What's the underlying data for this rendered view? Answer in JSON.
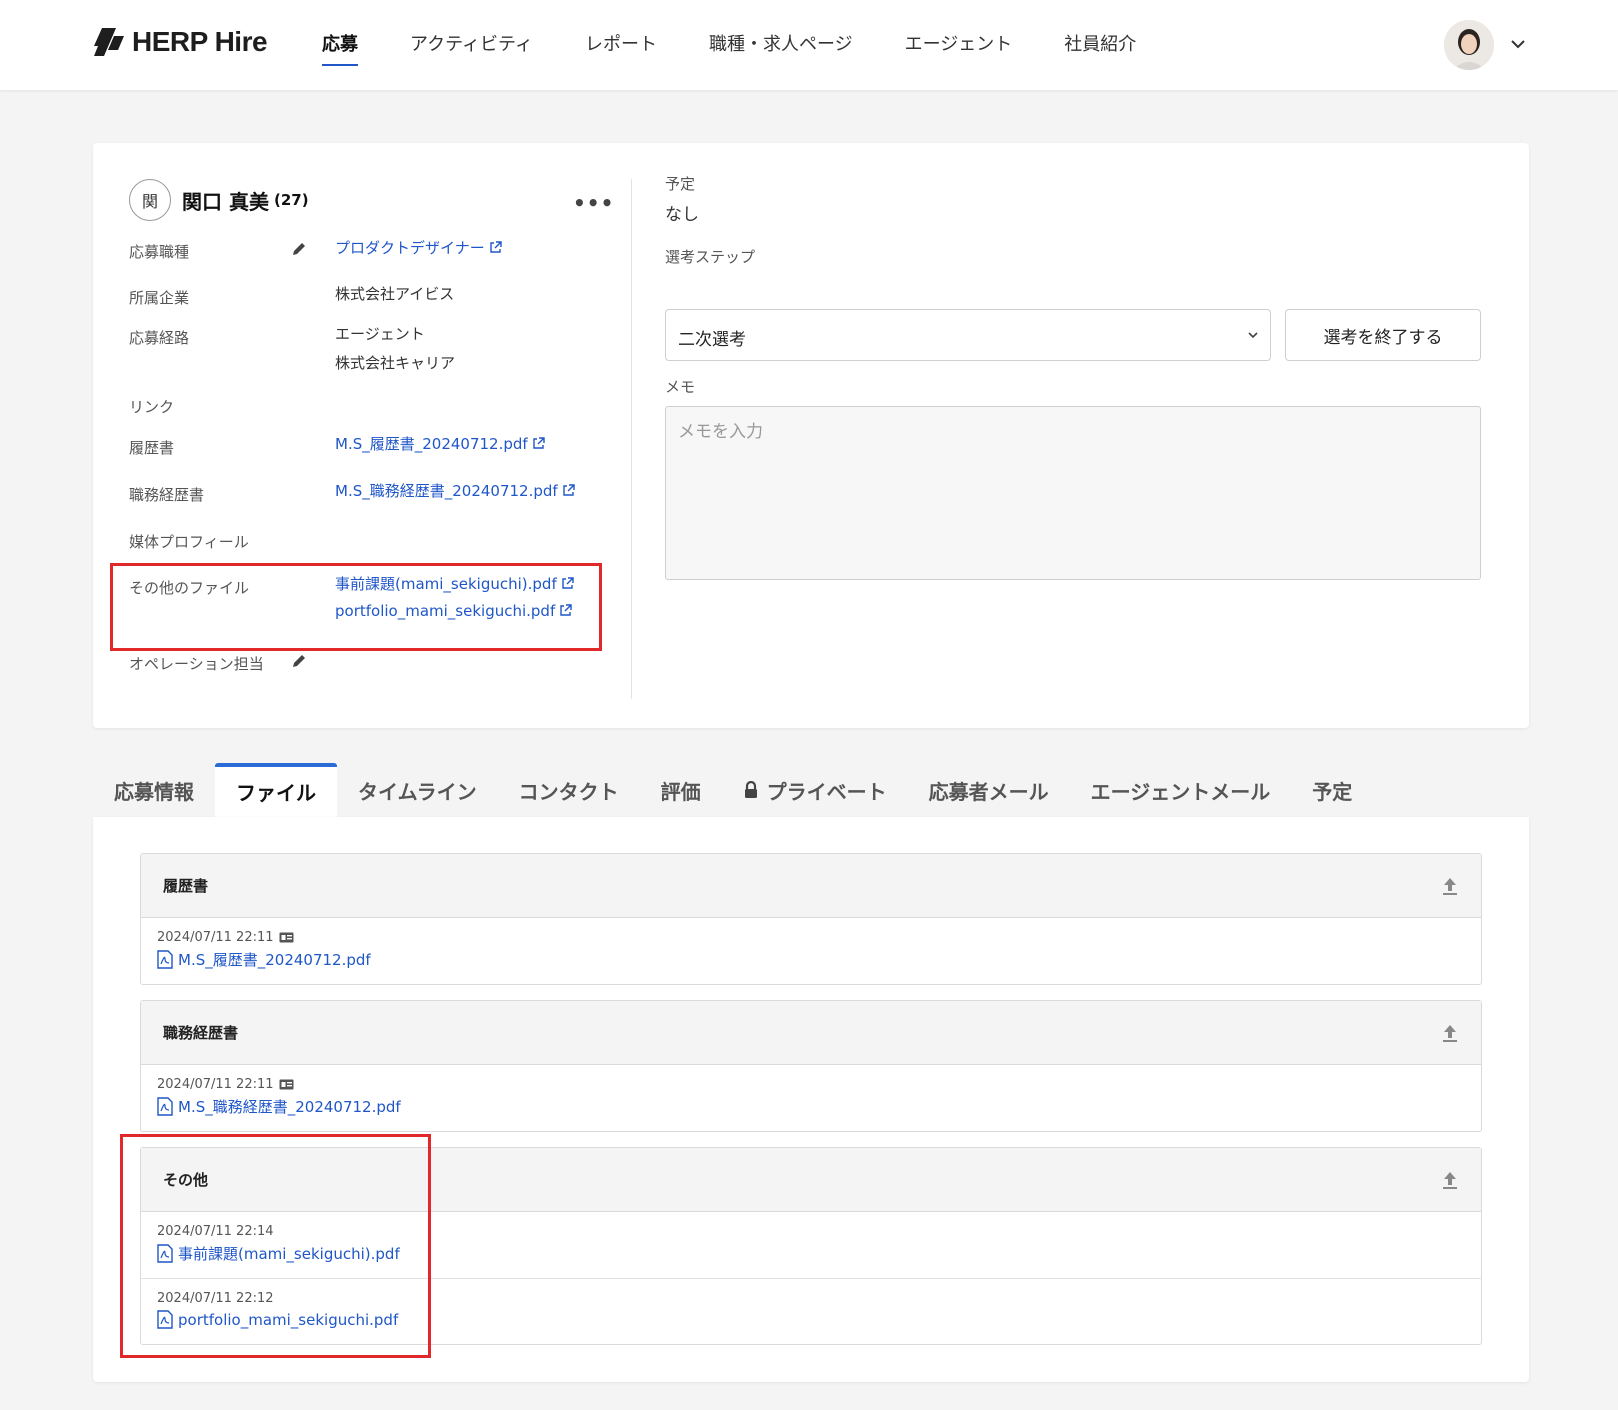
{
  "header": {
    "logo_text": "HERP Hire",
    "nav": [
      "応募",
      "アクティビティ",
      "レポート",
      "職種・求人ページ",
      "エージェント",
      "社員紹介"
    ]
  },
  "candidate": {
    "initial": "関",
    "name": "関口 真美",
    "age": "(27)",
    "fields": {
      "position_label": "応募職種",
      "position_value": "プロダクトデザイナー",
      "company_label": "所属企業",
      "company_value": "株式会社アイビス",
      "source_label": "応募経路",
      "source_value_1": "エージェント",
      "source_value_2": "株式会社キャリア",
      "link_label": "リンク",
      "resume_label": "履歴書",
      "resume_file": "M.S_履歴書_20240712.pdf",
      "cv_label": "職務経歴書",
      "cv_file": "M.S_職務経歴書_20240712.pdf",
      "media_label": "媒体プロフィール",
      "other_label": "その他のファイル",
      "other_file_1": "事前課題(mami_sekiguchi).pdf",
      "other_file_2": "portfolio_mami_sekiguchi.pdf",
      "operation_label": "オペレーション担当"
    }
  },
  "right": {
    "schedule_label": "予定",
    "schedule_value": "なし",
    "step_label": "選考ステップ",
    "step_value": "二次選考",
    "end_button": "選考を終了する",
    "memo_label": "メモ",
    "memo_placeholder": "メモを入力"
  },
  "tabs": [
    "応募情報",
    "ファイル",
    "タイムライン",
    "コンタクト",
    "評価",
    "プライベート",
    "応募者メール",
    "エージェントメール",
    "予定"
  ],
  "active_tab": "ファイル",
  "file_sections": [
    {
      "title": "履歴書",
      "files": [
        {
          "date": "2024/07/11 22:11",
          "name": "M.S_履歴書_20240712.pdf"
        }
      ]
    },
    {
      "title": "職務経歴書",
      "files": [
        {
          "date": "2024/07/11 22:11",
          "name": "M.S_職務経歴書_20240712.pdf"
        }
      ]
    },
    {
      "title": "その他",
      "files": [
        {
          "date": "2024/07/11 22:14",
          "name": "事前課題(mami_sekiguchi).pdf"
        },
        {
          "date": "2024/07/11 22:12",
          "name": "portfolio_mami_sekiguchi.pdf"
        }
      ]
    }
  ],
  "colors": {
    "link": "#1f56c8",
    "highlight": "#e1282a",
    "tab_accent": "#2a6bd6"
  }
}
